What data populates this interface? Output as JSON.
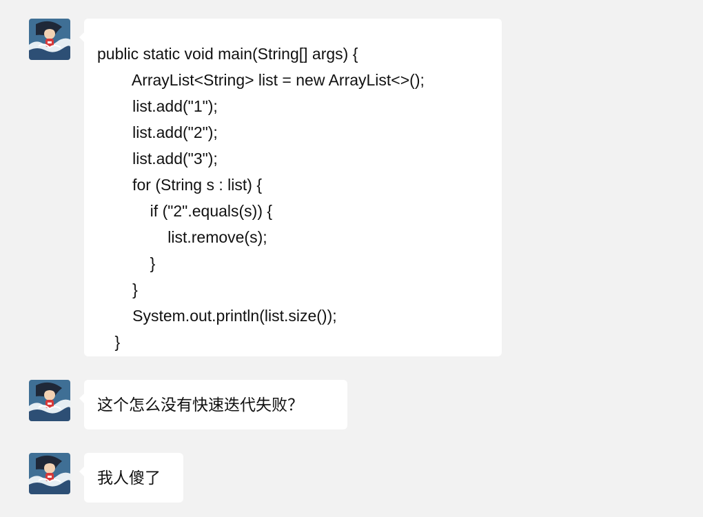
{
  "messages": [
    {
      "type": "code",
      "lines": [
        "public static void main(String[] args) {",
        "        ArrayList<String> list = new ArrayList<>();",
        "        list.add(\"1\");",
        "        list.add(\"2\");",
        "        list.add(\"3\");",
        "        for (String s : list) {",
        "            if (\"2\".equals(s)) {",
        "                list.remove(s);",
        "            }",
        "        }",
        "        System.out.println(list.size());",
        "    }"
      ]
    },
    {
      "type": "text",
      "text": "这个怎么没有快速迭代失败？"
    },
    {
      "type": "text",
      "text": "我人傻了"
    }
  ],
  "colors": {
    "background": "#f2f2f2",
    "bubble": "#ffffff",
    "text": "#111111"
  }
}
